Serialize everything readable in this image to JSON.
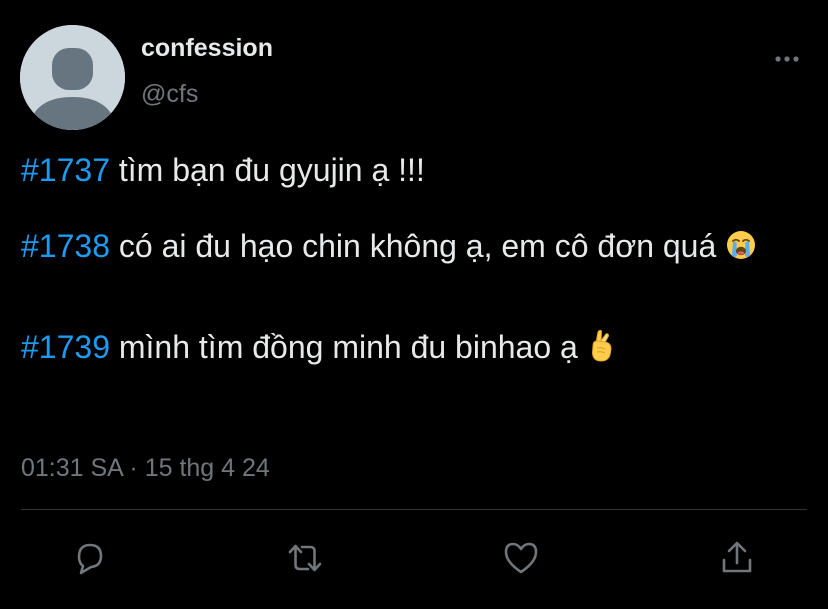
{
  "author": {
    "display_name": "confession",
    "handle": "@cfs",
    "avatar_icon": "default-avatar-icon"
  },
  "menu_icon": "more-horizontal-icon",
  "tweet": {
    "paragraphs": [
      {
        "hashtag": "#1737",
        "text": " tìm bạn đu gyujin ạ !!!",
        "emoji": ""
      },
      {
        "hashtag": "#1738",
        "text": " có ai đu hạo chin không ạ, em cô đơn quá ",
        "emoji": "loudly-crying-face-icon"
      },
      {
        "hashtag": "#1739",
        "text": " mình tìm đồng minh đu binhao ạ ",
        "emoji": "crossed-fingers-icon"
      }
    ]
  },
  "meta": {
    "time": "01:31 SA",
    "separator": " · ",
    "date": "15 thg 4 24"
  },
  "actions": [
    {
      "name": "reply",
      "icon": "reply-icon"
    },
    {
      "name": "retweet",
      "icon": "retweet-icon"
    },
    {
      "name": "like",
      "icon": "heart-icon"
    },
    {
      "name": "share",
      "icon": "share-icon"
    }
  ],
  "colors": {
    "background": "#000000",
    "text_primary": "#e7e9ea",
    "text_secondary": "#71767b",
    "accent": "#1d9bf0",
    "divider": "#2f3336",
    "avatar_bg": "#ccd6dd",
    "avatar_fg": "#66757f"
  }
}
